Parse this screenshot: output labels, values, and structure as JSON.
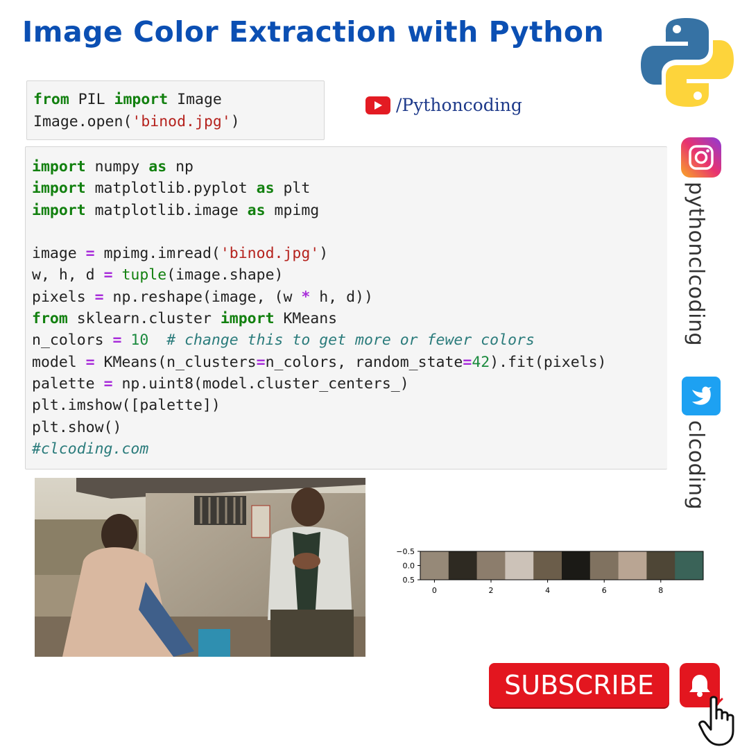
{
  "title": "Image Color Extraction with Python",
  "youtube": {
    "handle": "/Pythoncoding"
  },
  "social": {
    "instagram_handle": "pythonclcoding",
    "twitter_handle": "clcoding"
  },
  "code_cell_1": {
    "lines": [
      [
        {
          "t": "from",
          "c": "kw"
        },
        {
          "t": " PIL "
        },
        {
          "t": "import",
          "c": "kw"
        },
        {
          "t": " Image"
        }
      ],
      [
        {
          "t": "Image.open("
        },
        {
          "t": "'binod.jpg'",
          "c": "str"
        },
        {
          "t": ")"
        }
      ]
    ]
  },
  "code_cell_2": {
    "lines": [
      [
        {
          "t": "import",
          "c": "kw"
        },
        {
          "t": " numpy "
        },
        {
          "t": "as",
          "c": "kw"
        },
        {
          "t": " np"
        }
      ],
      [
        {
          "t": "import",
          "c": "kw"
        },
        {
          "t": " matplotlib.pyplot "
        },
        {
          "t": "as",
          "c": "kw"
        },
        {
          "t": " plt"
        }
      ],
      [
        {
          "t": "import",
          "c": "kw"
        },
        {
          "t": " matplotlib.image "
        },
        {
          "t": "as",
          "c": "kw"
        },
        {
          "t": " mpimg"
        }
      ],
      [
        {
          "t": ""
        }
      ],
      [
        {
          "t": "image "
        },
        {
          "t": "=",
          "c": "op"
        },
        {
          "t": " mpimg.imread("
        },
        {
          "t": "'binod.jpg'",
          "c": "str"
        },
        {
          "t": ")"
        }
      ],
      [
        {
          "t": "w, h, d "
        },
        {
          "t": "=",
          "c": "op"
        },
        {
          "t": " "
        },
        {
          "t": "tuple",
          "c": "bi"
        },
        {
          "t": "(image.shape)"
        }
      ],
      [
        {
          "t": "pixels "
        },
        {
          "t": "=",
          "c": "op"
        },
        {
          "t": " np.reshape(image, (w "
        },
        {
          "t": "*",
          "c": "op"
        },
        {
          "t": " h, d))"
        }
      ],
      [
        {
          "t": "from",
          "c": "kw"
        },
        {
          "t": " sklearn.cluster "
        },
        {
          "t": "import",
          "c": "kw"
        },
        {
          "t": " KMeans"
        }
      ],
      [
        {
          "t": "n_colors "
        },
        {
          "t": "=",
          "c": "op"
        },
        {
          "t": " "
        },
        {
          "t": "10",
          "c": "num"
        },
        {
          "t": "  "
        },
        {
          "t": "# change this to get more or fewer colors",
          "c": "cm"
        }
      ],
      [
        {
          "t": "model "
        },
        {
          "t": "=",
          "c": "op"
        },
        {
          "t": " KMeans(n_clusters"
        },
        {
          "t": "=",
          "c": "op"
        },
        {
          "t": "n_colors, random_state"
        },
        {
          "t": "=",
          "c": "op"
        },
        {
          "t": "42",
          "c": "num"
        },
        {
          "t": ").fit(pixels)"
        }
      ],
      [
        {
          "t": "palette "
        },
        {
          "t": "=",
          "c": "op"
        },
        {
          "t": " np.uint8(model.cluster_centers_)"
        }
      ],
      [
        {
          "t": "plt.imshow([palette])"
        }
      ],
      [
        {
          "t": "plt.show()"
        }
      ],
      [
        {
          "t": "#clcoding.com",
          "c": "cm"
        }
      ]
    ]
  },
  "palette_plot": {
    "colors": [
      "#968978",
      "#2e2a22",
      "#8c7d6c",
      "#ccc2b8",
      "#6b5d4a",
      "#1b1a16",
      "#807260",
      "#b9a593",
      "#4e4636",
      "#3a6358"
    ],
    "yticks": [
      "−0.5",
      "0.0",
      "0.5"
    ],
    "xticks": [
      "0",
      "2",
      "4",
      "6",
      "8"
    ],
    "xtick_values": [
      0,
      2,
      4,
      6,
      8
    ]
  },
  "subscribe_label": "SUBSCRIBE",
  "icons": {
    "python_logo": "python-logo",
    "youtube": "youtube-icon",
    "instagram": "instagram-icon",
    "twitter": "twitter-icon",
    "bell": "bell-icon",
    "hand": "hand-cursor-icon"
  }
}
